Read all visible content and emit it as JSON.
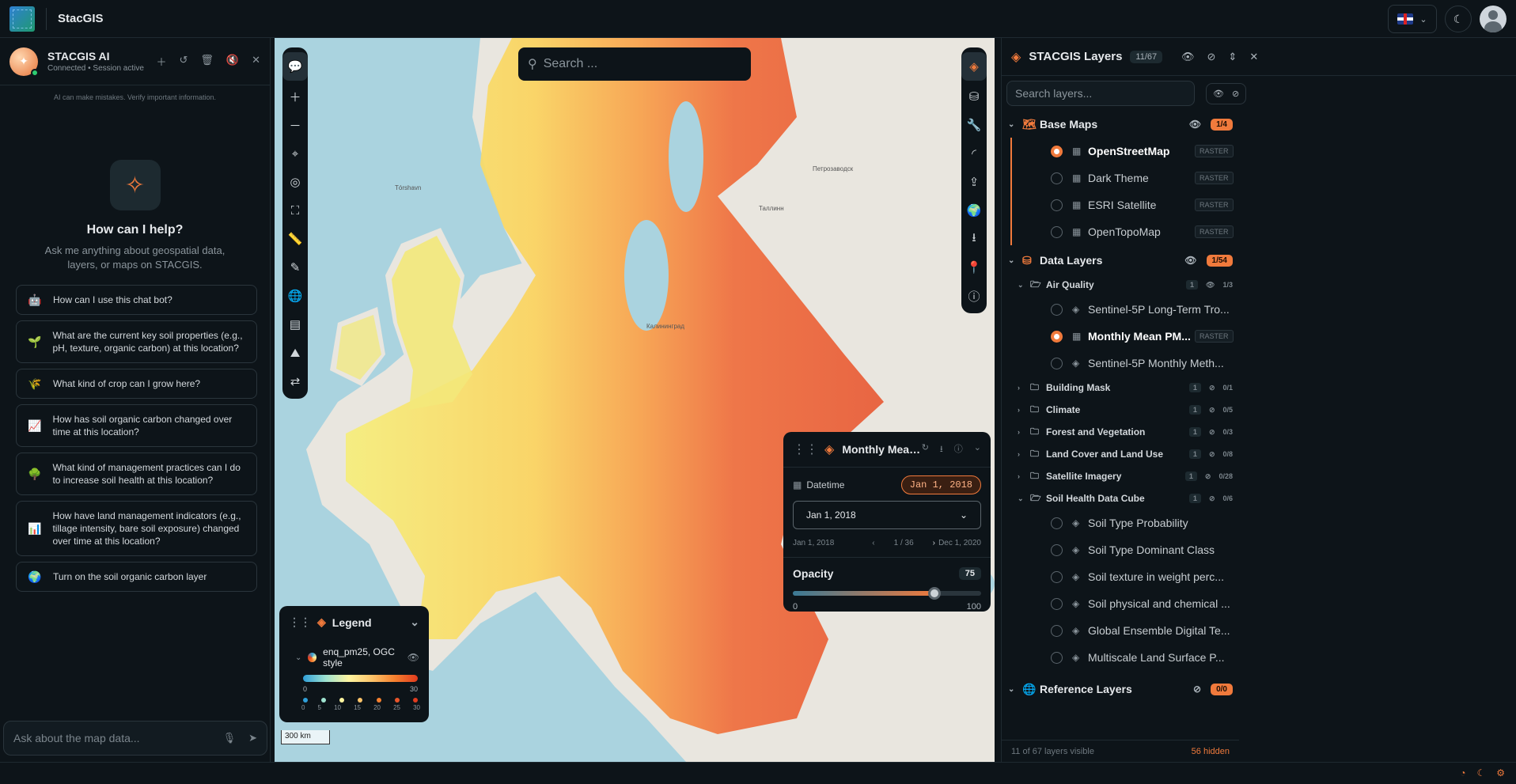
{
  "app": {
    "brand": "StacGIS"
  },
  "chat": {
    "title": "STACGIS AI",
    "status": "Connected • Session active",
    "disclaimer": "AI can make mistakes. Verify important information.",
    "help_title": "How can I help?",
    "help_sub": "Ask me anything about geospatial data, layers, or maps on STACGIS.",
    "suggestions": [
      {
        "icon": "robot-icon",
        "glyph": "🤖",
        "text": "How can I use this chat bot?"
      },
      {
        "icon": "seedling-icon",
        "glyph": "🌱",
        "text": "What are the current key soil properties (e.g., pH, texture, organic carbon) at this location?"
      },
      {
        "icon": "wheat-icon",
        "glyph": "🌾",
        "text": "What kind of crop can I grow here?"
      },
      {
        "icon": "chart-icon",
        "glyph": "📈",
        "text": "How has soil organic carbon changed over time at this location?"
      },
      {
        "icon": "tree-icon",
        "glyph": "🌳",
        "text": "What kind of management practices can I do to increase soil health at this location?"
      },
      {
        "icon": "bar-chart-icon",
        "glyph": "📊",
        "text": "How have land management indicators (e.g., tillage intensity, bare soil exposure) changed over time at this location?"
      },
      {
        "icon": "globe-icon",
        "glyph": "🌍",
        "text": "Turn on the soil organic carbon layer"
      }
    ],
    "input_placeholder": "Ask about the map data..."
  },
  "map": {
    "search_placeholder": "Search ...",
    "scale": "300 km",
    "legend": {
      "title": "Legend",
      "layer": "enq_pm25, OGC style",
      "range": [
        "0",
        "30"
      ],
      "stops": [
        "0",
        "5",
        "10",
        "15",
        "20",
        "25",
        "30"
      ],
      "colors": [
        "#2f9fd8",
        "#9fe3d0",
        "#fff5a0",
        "#fdc46a",
        "#f5802f",
        "#e8552a",
        "#e03b1e"
      ]
    },
    "time_panel": {
      "title": "Monthly Mean PM2...",
      "datetime_label": "Datetime",
      "date_chip": "Jan 1, 2018",
      "selected": "Jan 1, 2018",
      "start": "Jan 1, 2018",
      "page": "1 / 36",
      "end": "Dec 1, 2020",
      "opacity_label": "Opacity",
      "opacity": 75,
      "min": "0",
      "max": "100"
    },
    "labels": {
      "tallinn": "Таллинн",
      "petro": "Петрозаводск",
      "kaliningrad": "Калининград",
      "torshavn": "Tórshavn"
    }
  },
  "layers": {
    "title": "STACGIS Layers",
    "count": "11/67",
    "search_placeholder": "Search layers...",
    "base": {
      "title": "Base Maps",
      "badge": "1/4",
      "items": [
        {
          "name": "OpenStreetMap",
          "tag": "RASTER",
          "on": true
        },
        {
          "name": "Dark Theme",
          "tag": "RASTER",
          "on": false
        },
        {
          "name": "ESRI Satellite",
          "tag": "RASTER",
          "on": false
        },
        {
          "name": "OpenTopoMap",
          "tag": "RASTER",
          "on": false
        }
      ]
    },
    "data": {
      "title": "Data Layers",
      "badge": "1/54",
      "air_quality": {
        "name": "Air Quality",
        "pill": "1",
        "count": "1/3"
      },
      "air_items": [
        {
          "name": "Sentinel-5P Long-Term Tro...",
          "tag": "",
          "on": false
        },
        {
          "name": "Monthly Mean PM...",
          "tag": "RASTER",
          "on": true
        },
        {
          "name": "Sentinel-5P Monthly Meth...",
          "tag": "",
          "on": false
        }
      ],
      "folders": [
        {
          "name": "Building Mask",
          "pill": "1",
          "count": "0/1"
        },
        {
          "name": "Climate",
          "pill": "1",
          "count": "0/5"
        },
        {
          "name": "Forest and Vegetation",
          "pill": "1",
          "count": "0/3"
        },
        {
          "name": "Land Cover and Land Use",
          "pill": "1",
          "count": "0/8"
        },
        {
          "name": "Satellite Imagery",
          "pill": "1",
          "count": "0/28"
        }
      ],
      "soil": {
        "name": "Soil Health Data Cube",
        "pill": "1",
        "count": "0/6"
      },
      "soil_items": [
        {
          "name": "Soil Type Probability"
        },
        {
          "name": "Soil Type Dominant Class"
        },
        {
          "name": "Soil texture in weight perc..."
        },
        {
          "name": "Soil physical and chemical ..."
        },
        {
          "name": "Global Ensemble Digital Te..."
        },
        {
          "name": "Multiscale Land Surface P..."
        }
      ]
    },
    "reference": {
      "title": "Reference Layers",
      "badge": "0/0"
    },
    "footer": {
      "visible": "11 of 67 layers visible",
      "hidden": "56 hidden"
    }
  }
}
